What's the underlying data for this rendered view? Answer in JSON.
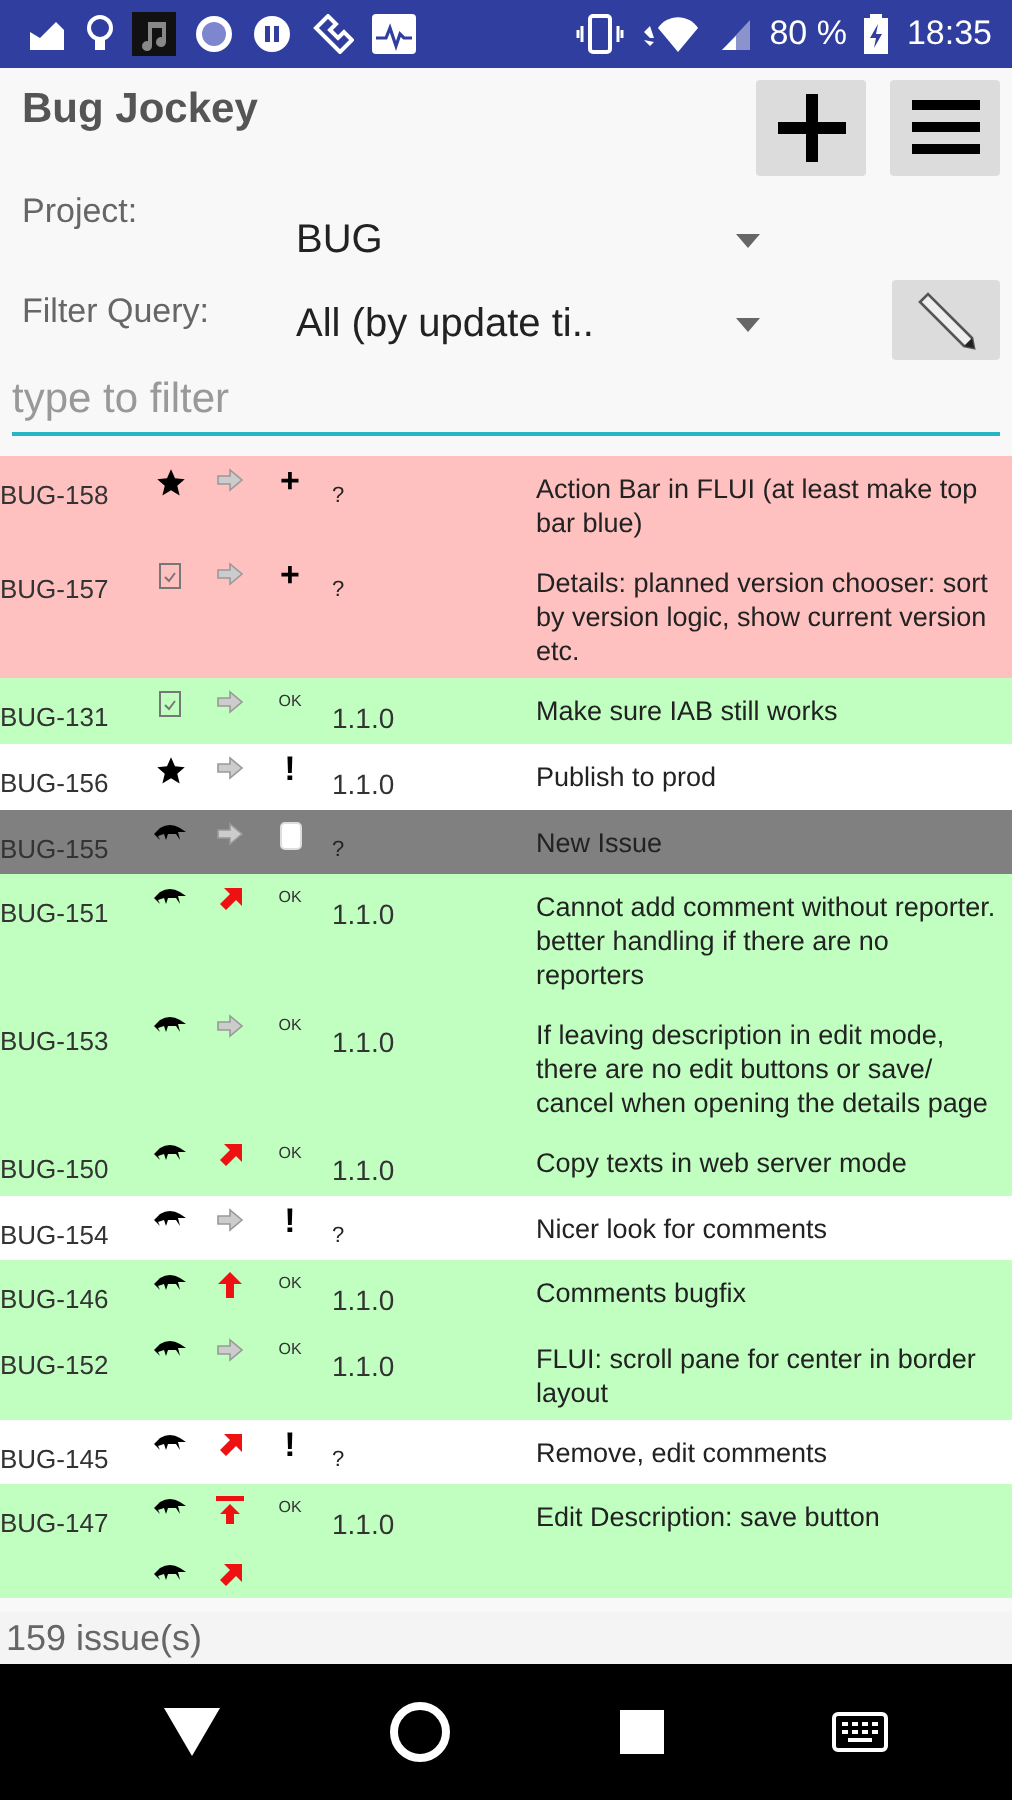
{
  "status_bar": {
    "battery": "80 %",
    "time": "18:35"
  },
  "app": {
    "title": "Bug Jockey"
  },
  "project": {
    "label": "Project:",
    "value": "BUG"
  },
  "filter_query": {
    "label": "Filter Query:",
    "value": "All (by update ti.."
  },
  "search": {
    "placeholder": "type to filter"
  },
  "issues": [
    {
      "id": "BUG-158",
      "type": {
        "kind": "star"
      },
      "priority": {
        "kind": "normal"
      },
      "status": {
        "kind": "text",
        "text": "+"
      },
      "version": "?",
      "summary": "Action Bar in FLUI (at least make top bar blue)",
      "color": "#ffc0c0"
    },
    {
      "id": "BUG-157",
      "type": {
        "kind": "task"
      },
      "priority": {
        "kind": "normal"
      },
      "status": {
        "kind": "text",
        "text": "+"
      },
      "version": "?",
      "summary": "Details: planned version chooser: sort by version logic, show current version etc.",
      "color": "#ffc0c0"
    },
    {
      "id": "BUG-131",
      "type": {
        "kind": "task"
      },
      "priority": {
        "kind": "normal"
      },
      "status": {
        "kind": "small",
        "text": "OK"
      },
      "version": "1.1.0",
      "summary": "Make sure IAB still works",
      "color": "#c0ffc0"
    },
    {
      "id": "BUG-156",
      "type": {
        "kind": "star"
      },
      "priority": {
        "kind": "normal"
      },
      "status": {
        "kind": "text",
        "text": "!"
      },
      "version": "1.1.0",
      "summary": "Publish to prod",
      "color": "#ffffff"
    },
    {
      "id": "BUG-155",
      "type": {
        "kind": "bug"
      },
      "priority": {
        "kind": "normal"
      },
      "status": {
        "kind": "note"
      },
      "version": "?",
      "summary": "New Issue",
      "color": "#808080"
    },
    {
      "id": "BUG-151",
      "type": {
        "kind": "bug"
      },
      "priority": {
        "kind": "major"
      },
      "status": {
        "kind": "small",
        "text": "OK"
      },
      "version": "1.1.0",
      "summary": "Cannot add comment without reporter. better handling if there are no reporters",
      "color": "#c0ffc0"
    },
    {
      "id": "BUG-153",
      "type": {
        "kind": "bug"
      },
      "priority": {
        "kind": "normal"
      },
      "status": {
        "kind": "small",
        "text": "OK"
      },
      "version": "1.1.0",
      "summary": "If leaving description in edit mode, there are no edit buttons or save/ cancel when opening the details page",
      "color": "#c0ffc0"
    },
    {
      "id": "BUG-150",
      "type": {
        "kind": "bug"
      },
      "priority": {
        "kind": "major"
      },
      "status": {
        "kind": "small",
        "text": "OK"
      },
      "version": "1.1.0",
      "summary": "Copy texts in web server mode",
      "color": "#c0ffc0"
    },
    {
      "id": "BUG-154",
      "type": {
        "kind": "bug"
      },
      "priority": {
        "kind": "normal"
      },
      "status": {
        "kind": "text",
        "text": "!"
      },
      "version": "?",
      "summary": "Nicer look for comments",
      "color": "#ffffff"
    },
    {
      "id": "BUG-146",
      "type": {
        "kind": "bug"
      },
      "priority": {
        "kind": "critical"
      },
      "status": {
        "kind": "small",
        "text": "OK"
      },
      "version": "1.1.0",
      "summary": "Comments bugfix",
      "color": "#c0ffc0"
    },
    {
      "id": "BUG-152",
      "type": {
        "kind": "bug"
      },
      "priority": {
        "kind": "normal"
      },
      "status": {
        "kind": "small",
        "text": "OK"
      },
      "version": "1.1.0",
      "summary": "FLUI: scroll pane for center in border layout",
      "color": "#c0ffc0"
    },
    {
      "id": "BUG-145",
      "type": {
        "kind": "bug"
      },
      "priority": {
        "kind": "major"
      },
      "status": {
        "kind": "text",
        "text": "!"
      },
      "version": "?",
      "summary": "Remove, edit comments",
      "color": "#ffffff"
    },
    {
      "id": "BUG-147",
      "type": {
        "kind": "bug"
      },
      "priority": {
        "kind": "blocker"
      },
      "status": {
        "kind": "small",
        "text": "OK"
      },
      "version": "1.1.0",
      "summary": "Edit Description: save button",
      "color": "#c0ffc0"
    },
    {
      "type": {
        "kind": "bug"
      },
      "priority": {
        "kind": "major"
      },
      "color": "#c0ffc0"
    }
  ],
  "footer": {
    "count": "159 issue(s)"
  }
}
